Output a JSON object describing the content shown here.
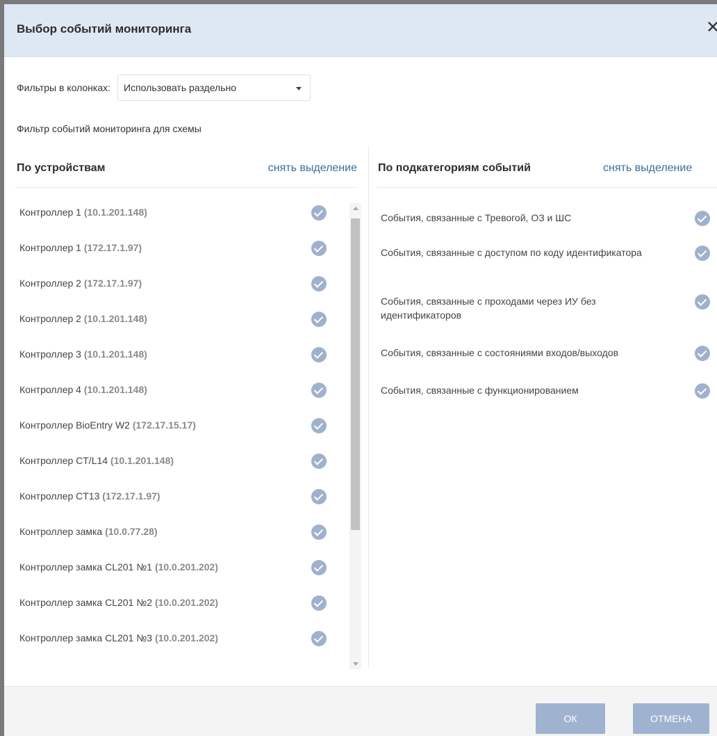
{
  "dialog": {
    "title": "Выбор событий мониторинга",
    "close_icon": "close-icon",
    "close_glyph": "✕"
  },
  "filter": {
    "label": "Фильтры в колонках:",
    "selected": "Использовать раздельно"
  },
  "subtitle": "Фильтр событий мониторинга для схемы",
  "devices": {
    "title": "По устройствам",
    "clear_label": "снять выделение",
    "items": [
      {
        "name": "Контроллер 1",
        "ip": "(10.1.201.148)",
        "checked": true
      },
      {
        "name": "Контроллер 1",
        "ip": "(172.17.1.97)",
        "checked": true
      },
      {
        "name": "Контроллер 2",
        "ip": "(172.17.1.97)",
        "checked": true
      },
      {
        "name": "Контроллер 2",
        "ip": "(10.1.201.148)",
        "checked": true
      },
      {
        "name": "Контроллер 3",
        "ip": "(10.1.201.148)",
        "checked": true
      },
      {
        "name": "Контроллер 4",
        "ip": "(10.1.201.148)",
        "checked": true
      },
      {
        "name": "Контроллер BioEntry W2",
        "ip": "(172.17.15.17)",
        "checked": true
      },
      {
        "name": "Контроллер CT/L14",
        "ip": "(10.1.201.148)",
        "checked": true
      },
      {
        "name": "Контроллер CT13",
        "ip": "(172.17.1.97)",
        "checked": true
      },
      {
        "name": "Контроллер замка",
        "ip": "(10.0.77.28)",
        "checked": true
      },
      {
        "name": "Контроллер замка CL201 №1",
        "ip": "(10.0.201.202)",
        "checked": true
      },
      {
        "name": "Контроллер замка CL201 №2",
        "ip": "(10.0.201.202)",
        "checked": true
      },
      {
        "name": "Контроллер замка CL201 №3",
        "ip": "(10.0.201.202)",
        "checked": true
      }
    ]
  },
  "categories": {
    "title": "По подкатегориям событий",
    "clear_label": "снять выделение",
    "items": [
      {
        "label": "События, связанные с Тревогой, ОЗ и ШС",
        "checked": true
      },
      {
        "label": "События, связанные с доступом по коду идентификатора",
        "checked": true
      },
      {
        "label": "События, связанные с проходами через ИУ без идентификаторов",
        "checked": true
      },
      {
        "label": "События, связанные с состояниями входов/выходов",
        "checked": true
      },
      {
        "label": "События, связанные с функционированием",
        "checked": true
      }
    ]
  },
  "footer": {
    "ok_label": "ОК",
    "cancel_label": "ОТМЕНА"
  },
  "colors": {
    "header_bg": "#dde8f3",
    "accent_link": "#3b6e9c",
    "check_bg": "#9fb1cc",
    "button_bg": "#9fb3d1"
  }
}
